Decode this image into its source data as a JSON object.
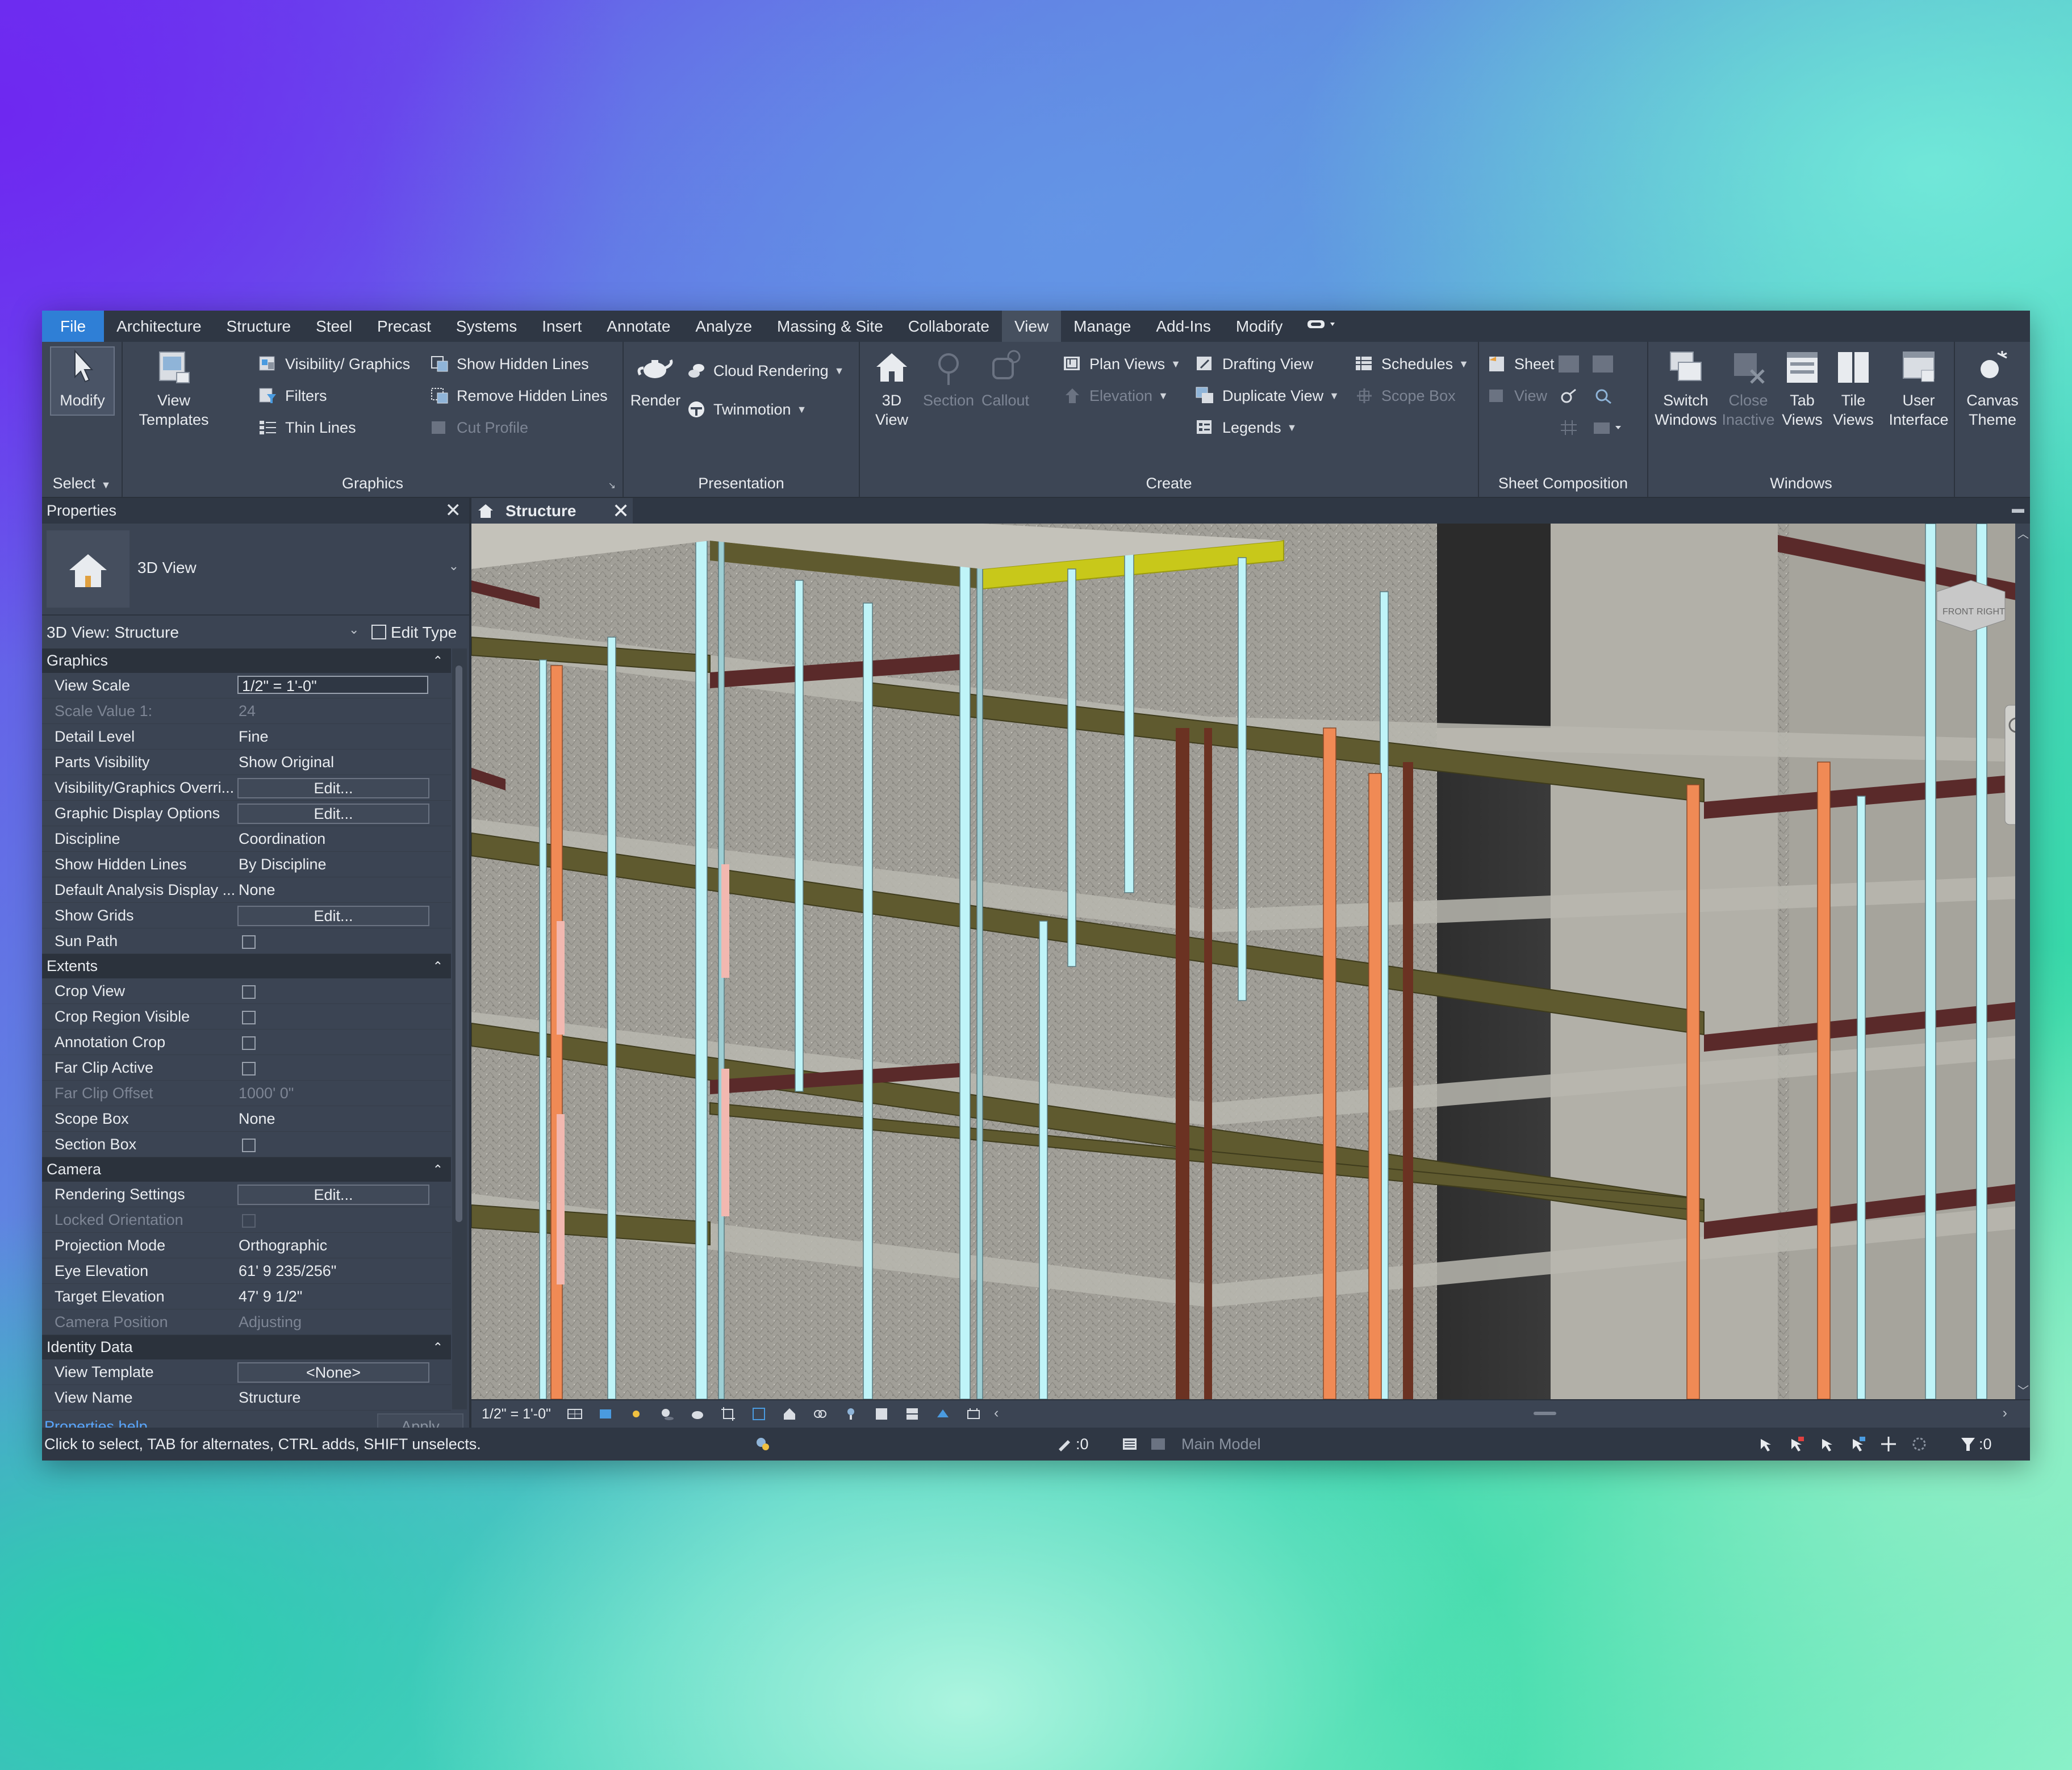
{
  "menu": {
    "tabs": [
      "File",
      "Architecture",
      "Structure",
      "Steel",
      "Precast",
      "Systems",
      "Insert",
      "Annotate",
      "Analyze",
      "Massing & Site",
      "Collaborate",
      "View",
      "Manage",
      "Add-Ins",
      "Modify"
    ],
    "active": "View"
  },
  "ribbon": {
    "select": {
      "modify": "Modify",
      "select": "Select"
    },
    "graphics": {
      "title": "Graphics",
      "view_templates_1": "View",
      "view_templates_2": "Templates",
      "visibility": "Visibility/ Graphics",
      "filters": "Filters",
      "thin_lines": "Thin  Lines",
      "show_hidden": "Show  Hidden Lines",
      "remove_hidden": "Remove  Hidden Lines",
      "cut_profile": "Cut  Profile"
    },
    "presentation": {
      "title": "Presentation",
      "render": "Render",
      "cloud_rendering": "Cloud  Rendering",
      "twinmotion": "Twinmotion"
    },
    "create": {
      "title": "Create",
      "view3d_1": "3D",
      "view3d_2": "View",
      "section": "Section",
      "callout": "Callout",
      "plan_views": "Plan  Views",
      "elevation": "Elevation",
      "drafting_view": "Drafting  View",
      "duplicate_view": "Duplicate  View",
      "legends": "Legends",
      "schedules": "Schedules",
      "scope_box": "Scope  Box"
    },
    "sheet": {
      "title": "Sheet Composition",
      "sheet": "Sheet",
      "view": "View"
    },
    "windows": {
      "title": "Windows",
      "switch_1": "Switch",
      "switch_2": "Windows",
      "close_1": "Close",
      "close_2": "Inactive",
      "tab_1": "Tab",
      "tab_2": "Views",
      "tile_1": "Tile",
      "tile_2": "Views",
      "ui_1": "User",
      "ui_2": "Interface"
    },
    "canvas": {
      "l1": "Canvas",
      "l2": "Theme"
    }
  },
  "properties": {
    "title": "Properties",
    "type_name": "3D View",
    "instance": "3D View: Structure",
    "edit_type": "Edit Type",
    "help": "Properties help",
    "apply": "Apply",
    "groups": [
      {
        "name": "Graphics",
        "rows": [
          {
            "k": "View Scale",
            "v": "1/2\" = 1'-0\"",
            "kind": "input"
          },
          {
            "k": "Scale Value    1:",
            "v": "24",
            "kind": "text",
            "disabled": true
          },
          {
            "k": "Detail Level",
            "v": "Fine",
            "kind": "text"
          },
          {
            "k": "Parts Visibility",
            "v": "Show Original",
            "kind": "text"
          },
          {
            "k": "Visibility/Graphics Overri...",
            "v": "Edit...",
            "kind": "button"
          },
          {
            "k": "Graphic Display Options",
            "v": "Edit...",
            "kind": "button"
          },
          {
            "k": "Discipline",
            "v": "Coordination",
            "kind": "text"
          },
          {
            "k": "Show Hidden Lines",
            "v": "By Discipline",
            "kind": "text"
          },
          {
            "k": "Default Analysis Display ...",
            "v": "None",
            "kind": "text"
          },
          {
            "k": "Show Grids",
            "v": "Edit...",
            "kind": "button"
          },
          {
            "k": "Sun Path",
            "v": "",
            "kind": "check"
          }
        ]
      },
      {
        "name": "Extents",
        "rows": [
          {
            "k": "Crop View",
            "v": "",
            "kind": "check"
          },
          {
            "k": "Crop Region Visible",
            "v": "",
            "kind": "check"
          },
          {
            "k": "Annotation Crop",
            "v": "",
            "kind": "check"
          },
          {
            "k": "Far Clip Active",
            "v": "",
            "kind": "check"
          },
          {
            "k": "Far Clip Offset",
            "v": "1000'  0\"",
            "kind": "text",
            "disabled": true
          },
          {
            "k": "Scope Box",
            "v": "None",
            "kind": "text"
          },
          {
            "k": "Section Box",
            "v": "",
            "kind": "check"
          }
        ]
      },
      {
        "name": "Camera",
        "rows": [
          {
            "k": "Rendering Settings",
            "v": "Edit...",
            "kind": "button"
          },
          {
            "k": "Locked Orientation",
            "v": "",
            "kind": "check",
            "disabled": true
          },
          {
            "k": "Projection Mode",
            "v": "Orthographic",
            "kind": "text"
          },
          {
            "k": "Eye Elevation",
            "v": "61'  9 235/256\"",
            "kind": "text"
          },
          {
            "k": "Target Elevation",
            "v": "47'  9 1/2\"",
            "kind": "text"
          },
          {
            "k": "Camera Position",
            "v": "Adjusting",
            "kind": "text",
            "disabled": true
          }
        ]
      },
      {
        "name": "Identity Data",
        "rows": [
          {
            "k": "View Template",
            "v": "<None>",
            "kind": "button"
          },
          {
            "k": "View Name",
            "v": "Structure",
            "kind": "text"
          }
        ]
      }
    ]
  },
  "view_tab": {
    "title": "Structure"
  },
  "view_control": {
    "scale": "1/2\" = 1'-0\""
  },
  "viewcube": {
    "front": "FRONT",
    "right": "RIGHT"
  },
  "status": {
    "message": "Click to select, TAB for alternates, CTRL adds, SHIFT unselects.",
    "worksets": ":0",
    "model": "Main Model",
    "filter_count": ":0"
  },
  "colors": {
    "file_tab": "#2f7fd6",
    "column_light": "#bff4f8",
    "column_orange": "#f08a55",
    "beam_olive": "#5f5a2f",
    "beam_dark": "#5a2a2a",
    "highlight_beam": "#c8c81a",
    "slab": "#a8a69e"
  }
}
